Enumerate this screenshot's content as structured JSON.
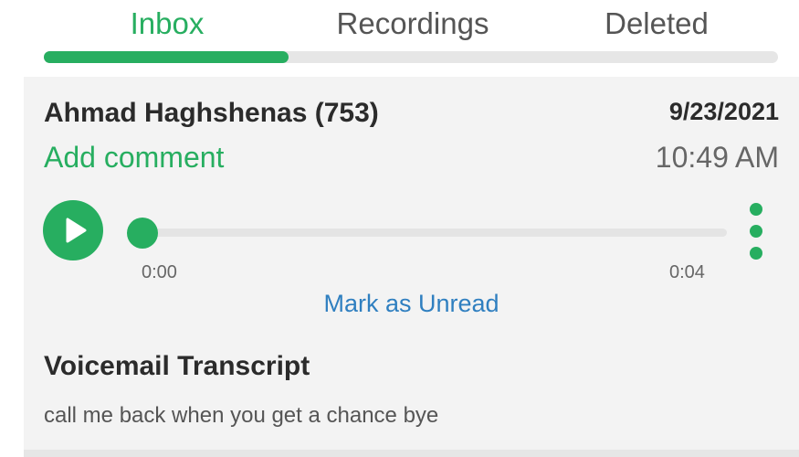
{
  "tabs": {
    "items": [
      {
        "label": "Inbox",
        "active": true
      },
      {
        "label": "Recordings",
        "active": false
      },
      {
        "label": "Deleted",
        "active": false
      }
    ],
    "indicator_position": "first-tab"
  },
  "voicemail": {
    "caller": "Ahmad Haghshenas (753)",
    "date": "9/23/2021",
    "time": "10:49 AM",
    "comment_link": "Add comment",
    "mark_unread_label": "Mark as Unread",
    "player": {
      "current_time": "0:00",
      "duration": "0:04",
      "progress": 0,
      "play_icon": "play-icon",
      "more_icon": "more-vertical-icon"
    },
    "transcript_title": "Voicemail Transcript",
    "transcript_text": "call me back when you get a chance bye"
  },
  "colors": {
    "accent": "#27ae60",
    "link": "#2f7fc0",
    "card_bg": "#f3f3f3",
    "text_dark": "#2b2b2b",
    "text_muted": "#666666"
  }
}
